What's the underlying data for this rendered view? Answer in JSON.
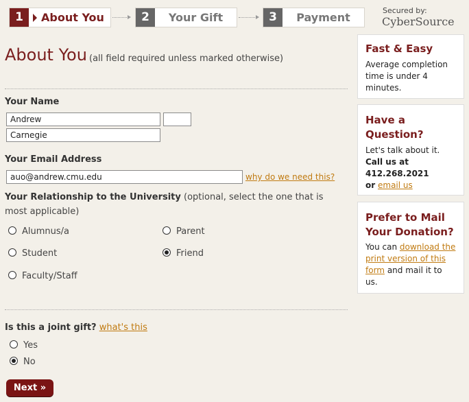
{
  "steps": [
    {
      "num": "1",
      "label": "About You"
    },
    {
      "num": "2",
      "label": "Your Gift"
    },
    {
      "num": "3",
      "label": "Payment"
    }
  ],
  "secured": {
    "label": "Secured by:",
    "brand": "CyberSource"
  },
  "page": {
    "title": "About You",
    "subtitle": "(all field required unless marked otherwise)"
  },
  "name": {
    "label": "Your Name",
    "first": "Andrew",
    "middle": "",
    "last": "Carnegie"
  },
  "email": {
    "label": "Your Email Address",
    "value": "auo@andrew.cmu.edu",
    "help_link": "why do we need this?"
  },
  "relationship": {
    "label": "Your Relationship to the University",
    "note": "(optional, select the one that is most applicable)",
    "options": [
      "Alumnus/a",
      "Parent",
      "Student",
      "Friend",
      "Faculty/Staff"
    ],
    "selected": "Friend"
  },
  "joint": {
    "label": "Is this a joint gift?",
    "help_link": "what's this",
    "options": [
      "Yes",
      "No"
    ],
    "selected": "No"
  },
  "next_button": "Next »",
  "sidebar": {
    "fast": {
      "title": "Fast & Easy",
      "text": "Average completion time is under 4 minutes."
    },
    "question": {
      "title": "Have a Question?",
      "text": "Let's talk about it.",
      "call": "Call us at 412.268.2021",
      "or": "or",
      "email_link": "email us"
    },
    "mail": {
      "title": "Prefer to Mail Your Donation?",
      "pre": "You can",
      "link": "download the print version of this form",
      "post": "and mail it to us."
    }
  },
  "colors": {
    "accent": "#7a1e1e",
    "link": "#c07a10",
    "background": "#f3f0e9"
  }
}
